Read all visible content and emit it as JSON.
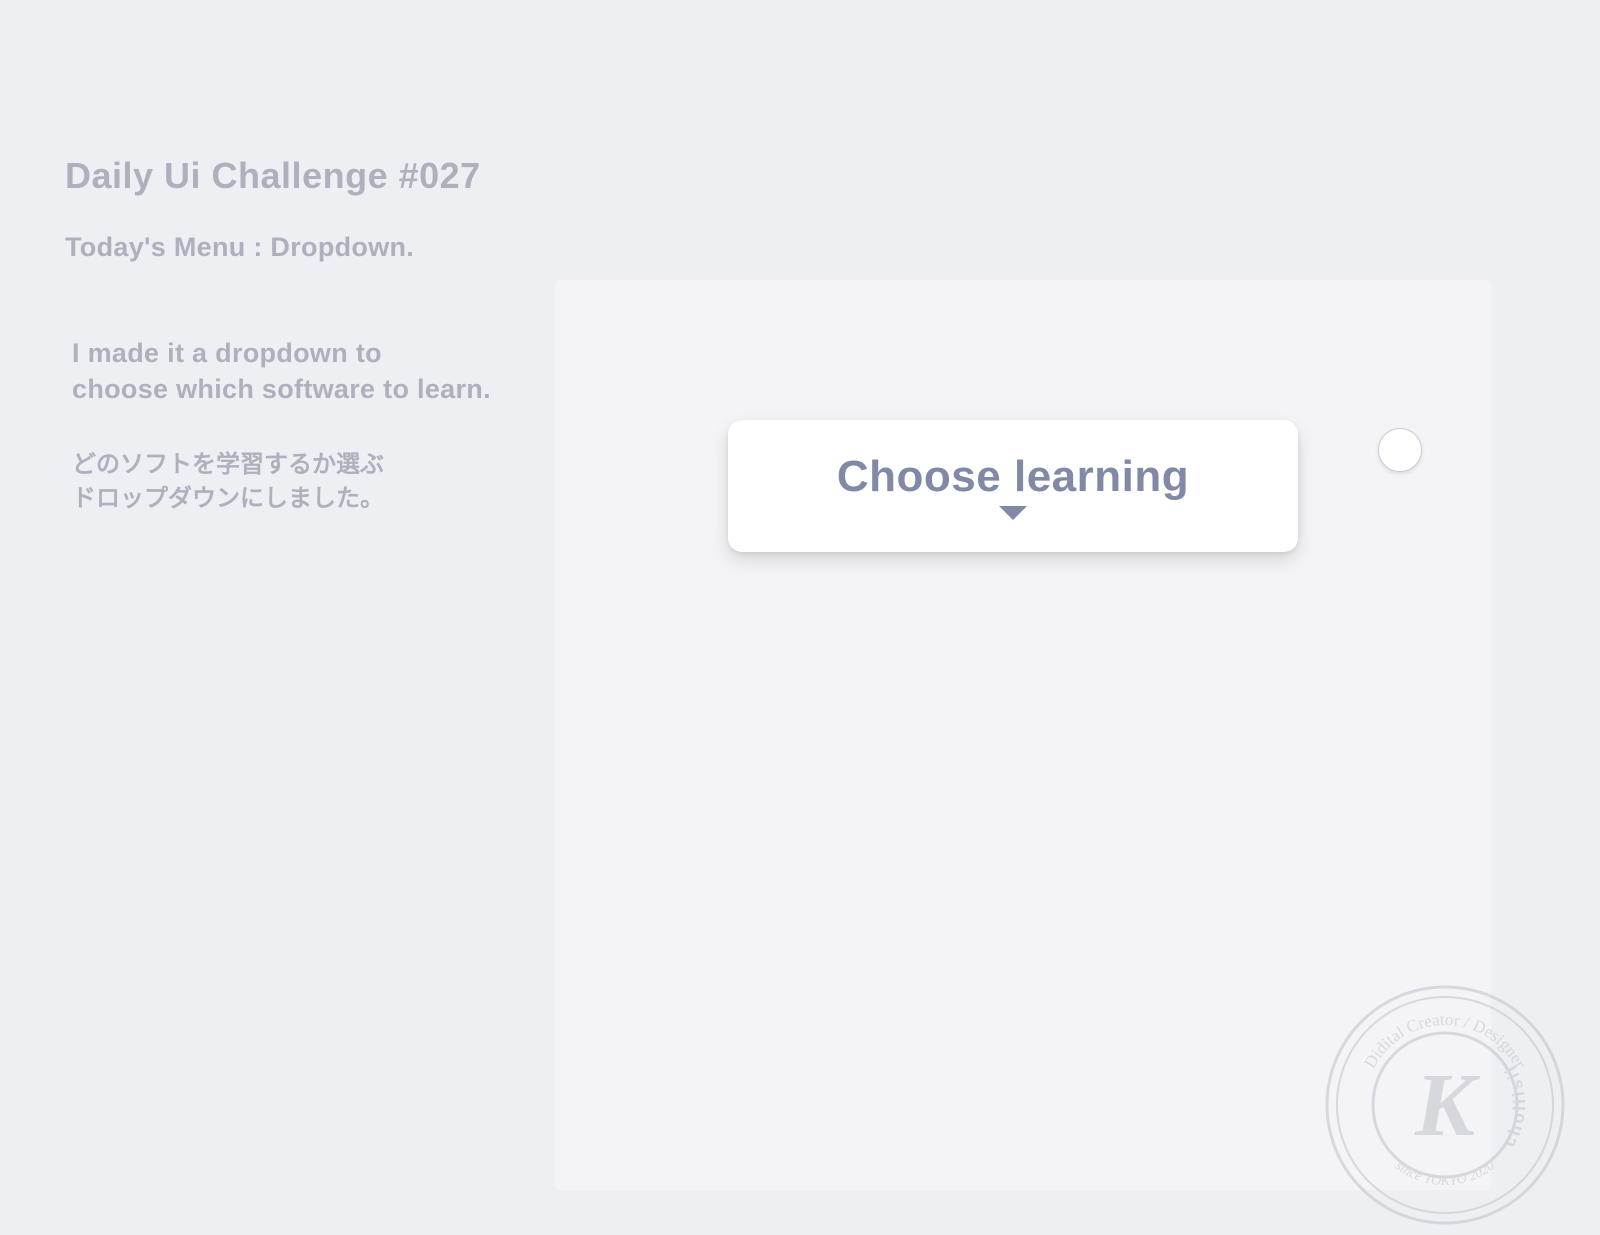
{
  "header": {
    "title": "Daily Ui Challenge #027",
    "subtitle": "Today's Menu : Dropdown."
  },
  "description": {
    "english": "I made it a dropdown to\nchoose which software to learn.",
    "japanese_line1": "どのソフトを学習するか選ぶ",
    "japanese_line2": "ドロップダウンにしました。"
  },
  "dropdown": {
    "label": "Choose learning"
  },
  "stamp": {
    "top_text": "Didital Creator / Designer",
    "side_text": "choliisii",
    "bottom_text": "since TOKYO 2020",
    "letter": "K"
  }
}
